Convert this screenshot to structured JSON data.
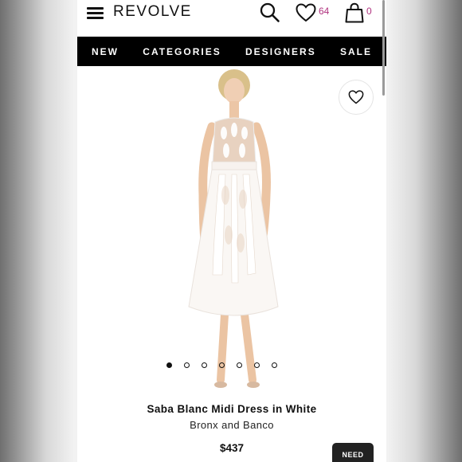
{
  "header": {
    "logo": "REVOLVE",
    "wishlist_count": "64",
    "cart_count": "0",
    "icons": [
      "menu-icon",
      "search-icon",
      "heart-icon",
      "shopping-bag-icon"
    ]
  },
  "nav": {
    "items": [
      "NEW",
      "CATEGORIES",
      "DESIGNERS",
      "SALE"
    ]
  },
  "gallery": {
    "image_count": 7,
    "active_index": 0
  },
  "product": {
    "name": "Saba Blanc Midi Dress in White",
    "brand": "Bronx and Banco",
    "price": "$437"
  },
  "help_button": {
    "label": "NEED"
  },
  "colors": {
    "nav_background": "#000000",
    "badge": "#b0327f",
    "text": "#111111"
  }
}
